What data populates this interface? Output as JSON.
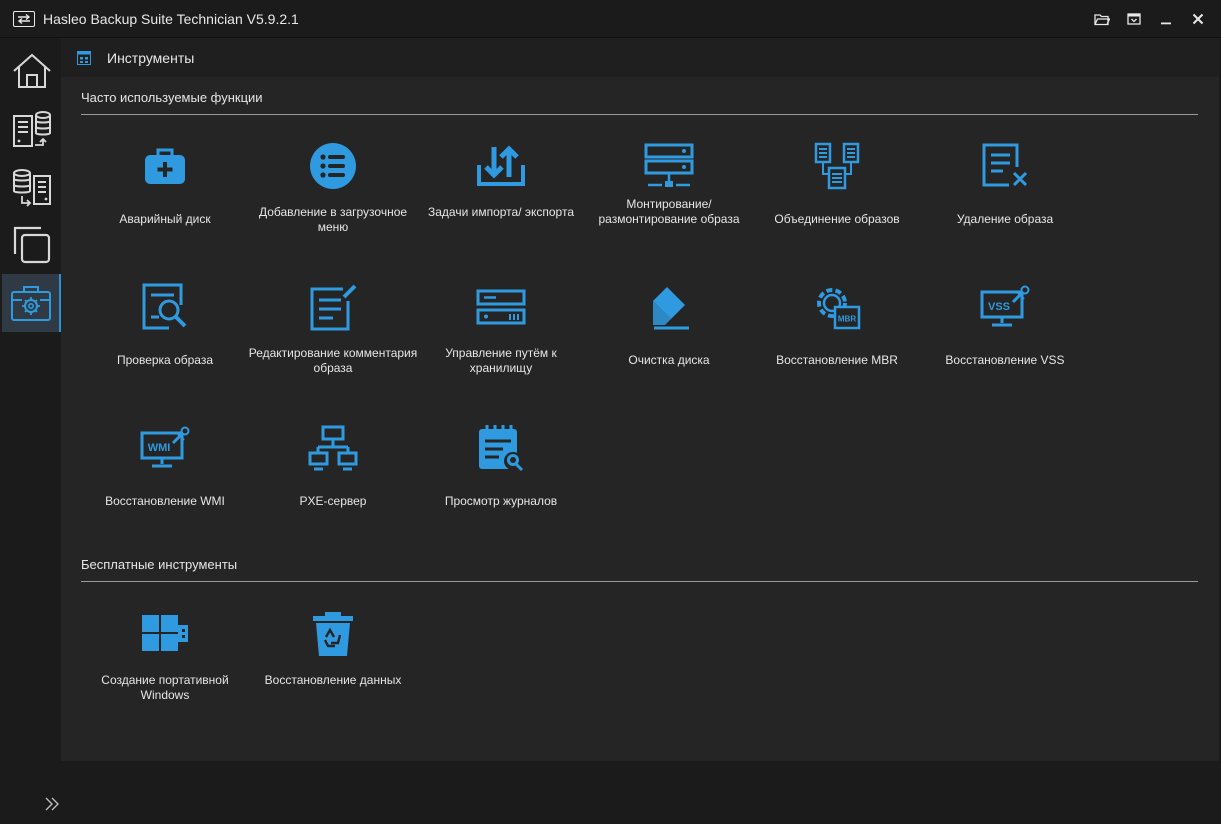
{
  "window": {
    "title": "Hasleo Backup Suite Technician V5.9.2.1"
  },
  "header": {
    "title": "Инструменты"
  },
  "sections": {
    "frequent": "Часто используемые функции",
    "free": "Бесплатные инструменты"
  },
  "tools": {
    "emergency_disk": "Аварийный диск",
    "boot_menu": "Добавление в загрузочное меню",
    "import_export": "Задачи импорта/ экспорта",
    "mount": "Монтирование/ размонтирование образа",
    "merge": "Объединение образов",
    "delete": "Удаление образа",
    "check": "Проверка образа",
    "edit_comment": "Редактирование комментария образа",
    "storage_path": "Управление путём к хранилищу",
    "wipe": "Очистка диска",
    "mbr": "Восстановление MBR",
    "vss": "Восстановление VSS",
    "wmi": "Восстановление WMI",
    "pxe": "PXE-сервер",
    "logs": "Просмотр журналов"
  },
  "free_tools": {
    "portable_windows": "Создание портативной Windows",
    "data_recovery": "Восстановление данных"
  },
  "icon_badges": {
    "mbr": "MBR",
    "vss": "VSS",
    "wmi": "WMI"
  },
  "colors": {
    "accent": "#2f9ae0",
    "background": "#252525",
    "sidebar": "#1b1b1b",
    "active_nav": "#303a44"
  },
  "icons": {
    "nav": [
      "home-icon",
      "backup-icon",
      "restore-icon",
      "clone-icon",
      "tools-icon"
    ],
    "window": [
      "folder-icon",
      "menu-icon",
      "minimize-icon",
      "close-icon"
    ]
  }
}
